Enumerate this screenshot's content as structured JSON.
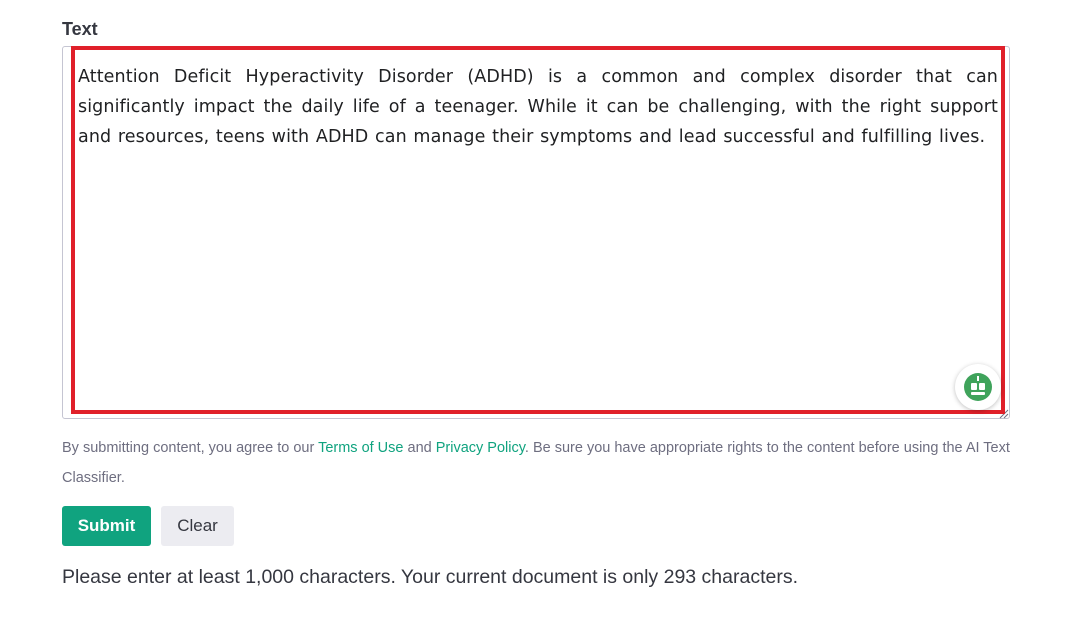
{
  "form": {
    "label": "Text",
    "textarea_value": "Attention Deficit Hyperactivity Disorder (ADHD) is a common and complex disorder that can significantly impact the daily life of a teenager. While it can be challenging, with the right support and resources, teens with ADHD can manage their symptoms and lead successful and fulfilling lives.",
    "assistant_icon": "robot-assistant-icon",
    "resize_icon": "resize-handle-icon"
  },
  "disclaimer": {
    "prefix": "By submitting content, you agree to our ",
    "terms_link": "Terms of Use",
    "middle": " and ",
    "privacy_link": "Privacy Policy",
    "suffix": ". Be sure you have appropriate rights to the content before using the AI Text Classifier."
  },
  "actions": {
    "submit_label": "Submit",
    "clear_label": "Clear"
  },
  "status": {
    "message": "Please enter at least 1,000 characters. Your current document is only 293 characters."
  },
  "colors": {
    "accent": "#10a37f",
    "highlight": "#e0202a",
    "assistant": "#3fa35b"
  }
}
